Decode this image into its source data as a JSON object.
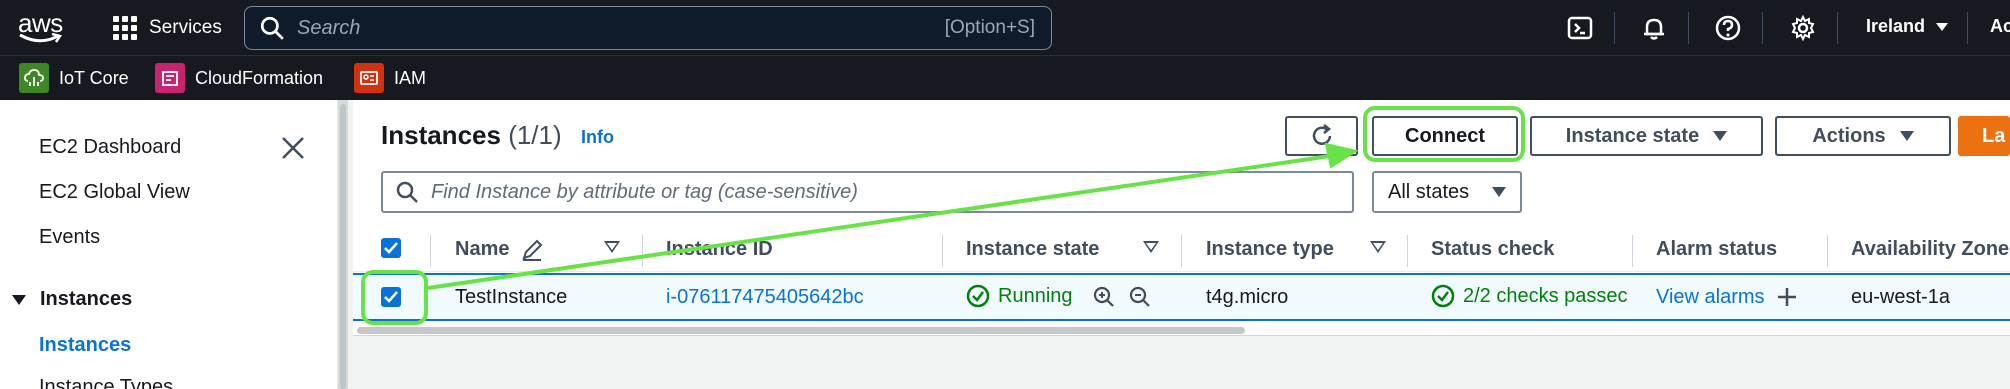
{
  "topnav": {
    "logo_text": "aws",
    "services_label": "Services",
    "search_placeholder": "Search",
    "search_shortcut": "[Option+S]",
    "region": "Ireland",
    "account_partial": "Ac",
    "icons": [
      "cloudshell-icon",
      "bell-icon",
      "help-icon",
      "gear-icon"
    ]
  },
  "favorites": [
    {
      "label": "IoT Core",
      "color": "#3f8624",
      "icon": "iot-core-icon"
    },
    {
      "label": "CloudFormation",
      "color": "#c7236f",
      "icon": "cloudformation-icon"
    },
    {
      "label": "IAM",
      "color": "#d13212",
      "icon": "iam-icon"
    }
  ],
  "sidebar": {
    "items": [
      "EC2 Dashboard",
      "EC2 Global View",
      "Events"
    ],
    "section": "Instances",
    "active": "Instances",
    "partial_next": "Instance Types"
  },
  "main": {
    "title": "Instances",
    "count": "(1/1)",
    "info": "Info",
    "buttons": {
      "connect": "Connect",
      "instance_state": "Instance state",
      "actions": "Actions",
      "launch_partial": "La"
    },
    "filter_placeholder": "Find Instance by attribute or tag (case-sensitive)",
    "states_select": "All states"
  },
  "table": {
    "headers": [
      "Name",
      "Instance ID",
      "Instance state",
      "Instance type",
      "Status check",
      "Alarm status",
      "Availability Zone"
    ],
    "row": {
      "name": "TestInstance",
      "instance_id": "i-076117475405642bc",
      "state": "Running",
      "type": "t4g.micro",
      "status_check": "2/2 checks passec",
      "alarm": "View alarms",
      "az": "eu-west-1a"
    }
  },
  "colors": {
    "nav_bg": "#16191f",
    "link": "#0972d3",
    "success": "#037f0c",
    "primary_button": "#ec7211",
    "annotation": "#67e347"
  }
}
